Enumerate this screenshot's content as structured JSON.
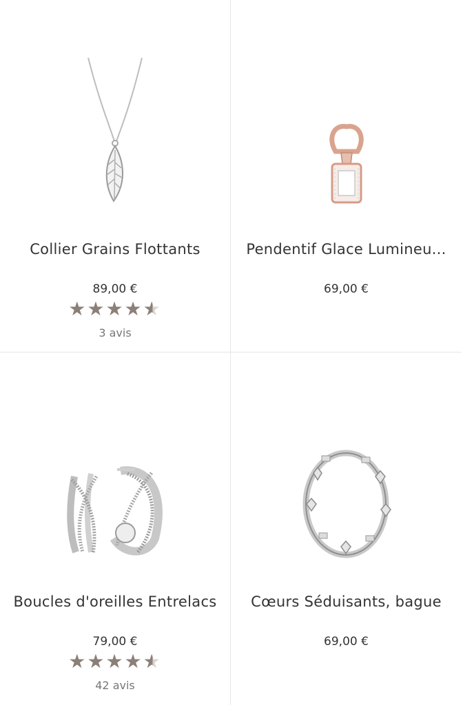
{
  "products": [
    {
      "name": "Collier Grains Flottants",
      "price": "89,00 €",
      "rating": 4.5,
      "reviews": "3 avis"
    },
    {
      "name": "Pendentif Glace Lumineu...",
      "price": "69,00 €"
    },
    {
      "name": "Boucles d'oreilles Entrelacs",
      "price": "79,00 €",
      "rating": 4.5,
      "reviews": "42 avis"
    },
    {
      "name": "Cœurs Séduisants, bague",
      "price": "69,00 €"
    }
  ],
  "colors": {
    "star": "#8c7f79",
    "star_empty": "#d9d2cf",
    "divider": "#e6e6e6",
    "rose_gold": "#d9a48f",
    "silver": "#c8c8c8"
  },
  "icons": {
    "star": "star-icon"
  }
}
